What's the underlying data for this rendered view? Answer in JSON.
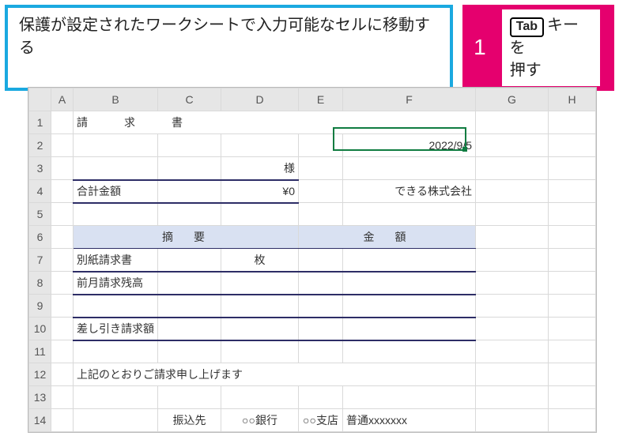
{
  "callouts": {
    "blue": "保護が設定されたワークシートで入力可能なセルに移動する",
    "pink_num": "1",
    "pink_key": "Tab",
    "pink_text1": "キーを",
    "pink_text2": "押す"
  },
  "columns": [
    "A",
    "B",
    "C",
    "D",
    "E",
    "F",
    "G",
    "H"
  ],
  "rows": [
    "1",
    "2",
    "3",
    "4",
    "5",
    "6",
    "7",
    "8",
    "9",
    "10",
    "11",
    "12",
    "13",
    "14"
  ],
  "cells": {
    "title": "請　求　書",
    "date": "2022/9/5",
    "sama": "様",
    "total_label": "合計金額",
    "total_value": "¥0",
    "company": "できる株式会社",
    "hdr_desc": "摘　要",
    "hdr_amount": "金　額",
    "r7_b": "別紙請求書",
    "r7_d": "枚",
    "r8_b": "前月請求残高",
    "r10_b": "差し引き請求額",
    "r12": "上記のとおりご請求申し上げます",
    "r14_b": "振込先",
    "r14_c": "○○銀行",
    "r14_d": "○○支店",
    "r14_e": "普通xxxxxxx"
  },
  "selection": {
    "cell": "F2"
  }
}
